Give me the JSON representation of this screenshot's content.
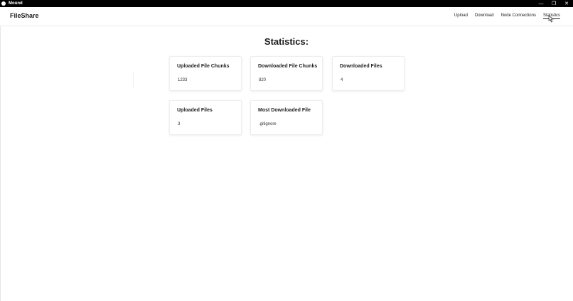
{
  "window": {
    "title": "Mound",
    "minimize_glyph": "—",
    "maximize_glyph": "❐",
    "close_glyph": "✕"
  },
  "navbar": {
    "brand": "FileShare",
    "links": [
      {
        "label": "Upload"
      },
      {
        "label": "Download"
      },
      {
        "label": "Node Connections"
      },
      {
        "label": "Statistics",
        "active": true
      }
    ]
  },
  "main": {
    "title": "Statistics:",
    "cards": [
      {
        "title": "Uploaded File Chunks",
        "value": "1233"
      },
      {
        "title": "Downloaded File Chunks",
        "value": "820"
      },
      {
        "title": "Downloaded Files",
        "value": "4"
      },
      {
        "title": "Uploaded Files",
        "value": "3"
      },
      {
        "title": "Most Downloaded File",
        "value": ".gitignore"
      }
    ]
  },
  "colors": {
    "titlebar_bg": "#000000",
    "page_bg": "#ffffff",
    "text": "#1a1a1a"
  }
}
